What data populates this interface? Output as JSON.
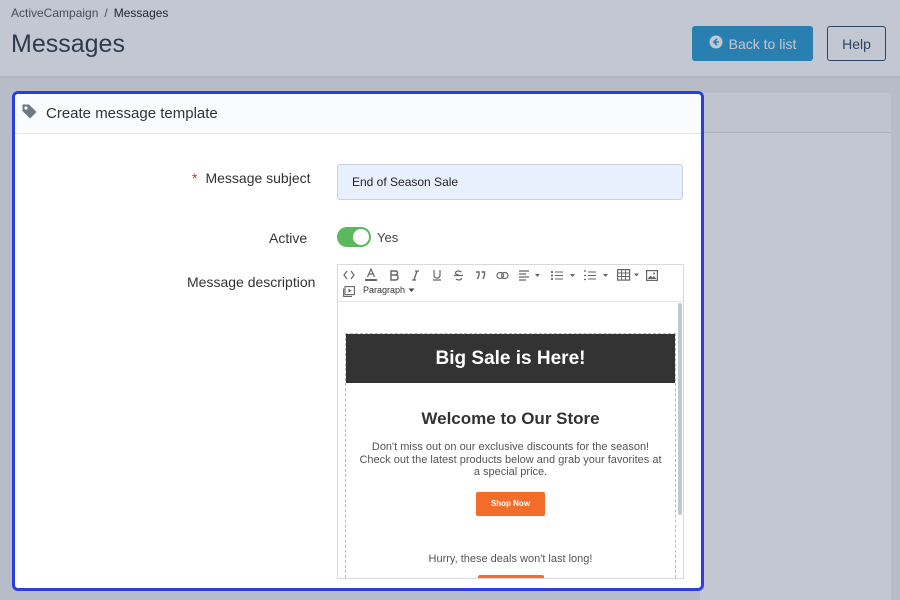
{
  "breadcrumb": {
    "root": "ActiveCampaign",
    "separator": "/",
    "current": "Messages"
  },
  "page": {
    "title": "Messages"
  },
  "header": {
    "back_label": "Back to list",
    "help_label": "Help",
    "accent": "#2b9bd3"
  },
  "modal": {
    "title": "Create message template",
    "border_color": "#2b3fe0",
    "subject": {
      "required_mark": "*",
      "label": "Message subject",
      "value": "End of Season Sale"
    },
    "active": {
      "label": "Active",
      "state_text": "Yes",
      "on": true,
      "color": "#5cb85c"
    },
    "description": {
      "label": "Message description",
      "toolbar": {
        "paragraph_label": "Paragraph"
      },
      "email": {
        "banner": "Big Sale is Here!",
        "heading": "Welcome to Our Store",
        "body": "Don't miss out on our exclusive discounts for the season! Check out the latest products below and grab your favorites at a special price.",
        "button": "Shop Now",
        "button_color": "#f36c2a",
        "footer": "Hurry, these deals won't last long!"
      }
    }
  }
}
